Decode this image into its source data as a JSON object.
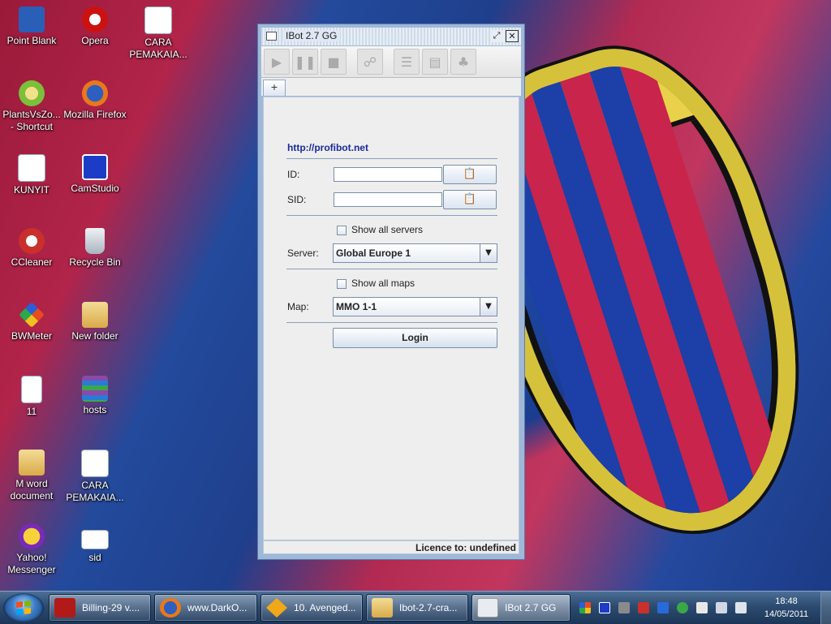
{
  "desktop": {
    "icons": [
      {
        "label": "Point Blank",
        "color": "#2a5fb8"
      },
      {
        "label": "Opera",
        "color": "#cc1111"
      },
      {
        "label": "CARA PEMAKAIA...",
        "color": "#ffffff"
      },
      {
        "label": "PlantsVsZo... - Shortcut",
        "color": "#7bbf3a"
      },
      {
        "label": "Mozilla Firefox",
        "color": "#e8781c"
      },
      {
        "label": "KUNYIT",
        "color": "#ffffff"
      },
      {
        "label": "CamStudio",
        "color": "#1c3cc8"
      },
      {
        "label": "CCleaner",
        "color": "#c9302c"
      },
      {
        "label": "Recycle Bin",
        "color": "#d8dde4"
      },
      {
        "label": "BWMeter",
        "color": "#e84c1c"
      },
      {
        "label": "New folder",
        "color": "#e8c66a"
      },
      {
        "label": "11",
        "color": "#ffffff"
      },
      {
        "label": "hosts",
        "color": "#8a4aa8"
      },
      {
        "label": "M word document",
        "color": "#e8c66a"
      },
      {
        "label": "CARA PEMAKAIA...",
        "color": "#ffffff"
      },
      {
        "label": "Yahoo! Messenger",
        "color": "#7a2ab8"
      },
      {
        "label": "sid",
        "color": "#ffffff"
      }
    ]
  },
  "window": {
    "title": "IBot 2.7 GG",
    "tab_label": "+",
    "toolbar": [
      "play-icon",
      "pause-icon",
      "stop-icon",
      "run-icon",
      "list-icon",
      "document-icon",
      "users-icon"
    ],
    "link": "http://profibot.net",
    "id_label": "ID:",
    "id_value": "",
    "sid_label": "SID:",
    "sid_value": "",
    "show_all_servers_label": "Show all servers",
    "show_all_servers_checked": false,
    "server_label": "Server:",
    "server_value": "Global Europe 1",
    "show_all_maps_label": "Show all maps",
    "show_all_maps_checked": false,
    "map_label": "Map:",
    "map_value": "MMO 1-1",
    "login_label": "Login",
    "status_text": "Licence to:  undefined"
  },
  "taskbar": {
    "tasks": [
      {
        "label": "Billing-29 v....",
        "color": "#b21a1a"
      },
      {
        "label": "www.DarkO...",
        "color": "#e8781c"
      },
      {
        "label": "10. Avenged...",
        "color": "#f0a818"
      },
      {
        "label": "Ibot-2.7-cra...",
        "color": "#e8c66a"
      },
      {
        "label": "IBot 2.7 GG",
        "color": "#d8dde4"
      }
    ],
    "time": "18:48",
    "date": "14/05/2011"
  }
}
